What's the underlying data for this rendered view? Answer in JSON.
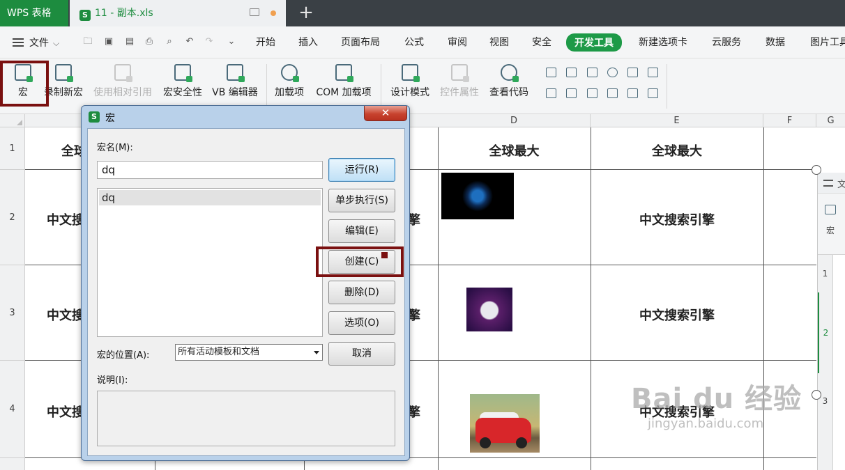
{
  "tabs": {
    "app_label": "WPS 表格",
    "doc_icon": "S",
    "doc_title": "11 - 副本.xls",
    "add_label": "+"
  },
  "menu": {
    "file_label": "文件",
    "items": [
      "开始",
      "插入",
      "页面布局",
      "公式",
      "审阅",
      "视图",
      "安全",
      "开发工具",
      "新建选项卡",
      "云服务",
      "数据",
      "图片工具"
    ]
  },
  "ribbon": {
    "macro": "宏",
    "record_macro": "录制新宏",
    "relative_ref": "使用相对引用",
    "macro_security": "宏安全性",
    "vb_editor": "VB 编辑器",
    "addins": "加载项",
    "com_addins": "COM 加载项",
    "design_mode": "设计模式",
    "control_props": "控件属性",
    "view_code": "查看代码"
  },
  "sheet": {
    "columns": [
      "D",
      "E",
      "F",
      "G"
    ],
    "rows": [
      "1",
      "2",
      "3",
      "4"
    ],
    "row1_texts": [
      "全球",
      "全球最大",
      "全球最大"
    ],
    "col_a_text": "中文搜",
    "col_c_text": "擎",
    "col_e_text": "中文搜索引擎",
    "images": [
      "globe-image",
      "purple-sphere-image",
      "red-car-image"
    ]
  },
  "right_panel": {
    "title_fragment": "文",
    "macro_label": "宏",
    "rows": [
      "1",
      "2",
      "3"
    ]
  },
  "dialog": {
    "icon": "S",
    "title": "宏",
    "close_label": "✕",
    "macro_name_label": "宏名(M):",
    "macro_name_value": "dq",
    "macro_list": [
      "dq"
    ],
    "location_label": "宏的位置(A):",
    "location_value": "所有活动模板和文档",
    "description_label": "说明(I):",
    "buttons": {
      "run": "运行(R)",
      "step": "单步执行(S)",
      "edit": "编辑(E)",
      "create": "创建(C)",
      "delete": "删除(D)",
      "options": "选项(O)",
      "cancel": "取消"
    }
  },
  "watermark": {
    "logo": "Bai du 经验",
    "url": "jingyan.baidu.com"
  },
  "colors": {
    "accent_green": "#1d9a47",
    "highlight_red": "#7a1010",
    "dialog_frame": "#b9d1ea"
  }
}
